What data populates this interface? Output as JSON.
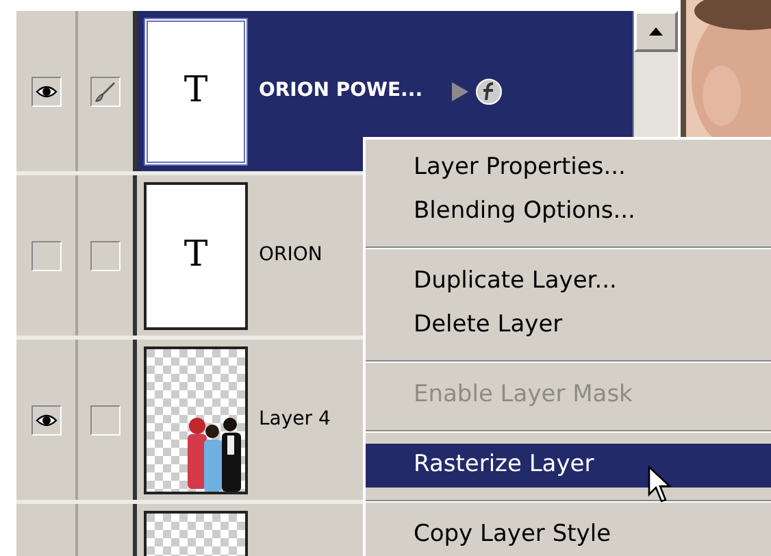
{
  "layers": [
    {
      "name": "ORION POWE...",
      "visible": true,
      "brush": true,
      "selected": true,
      "thumbnail": {
        "kind": "text",
        "glyph": "T"
      },
      "expand_arrow": true,
      "effects": true
    },
    {
      "name": "ORION",
      "visible": false,
      "brush": false,
      "selected": false,
      "thumbnail": {
        "kind": "text",
        "glyph": "T"
      },
      "expand_arrow": false,
      "effects": false
    },
    {
      "name": "Layer 4",
      "visible": true,
      "brush": false,
      "selected": false,
      "expand_arrow": false,
      "effects": false
    },
    {
      "selected": false
    }
  ],
  "context_menu": [
    {
      "kind": "item",
      "label": "Layer Properties...",
      "disabled": false,
      "selected": false
    },
    {
      "kind": "item",
      "label": "Blending Options...",
      "disabled": false,
      "selected": false
    },
    {
      "kind": "separator"
    },
    {
      "kind": "item",
      "label": "Duplicate Layer...",
      "disabled": false,
      "selected": false
    },
    {
      "kind": "item",
      "label": "Delete Layer",
      "disabled": false,
      "selected": false
    },
    {
      "kind": "separator"
    },
    {
      "kind": "item",
      "label": "Enable Layer Mask",
      "disabled": true,
      "selected": false
    },
    {
      "kind": "separator"
    },
    {
      "kind": "item",
      "label": "Rasterize Layer",
      "disabled": false,
      "selected": true
    },
    {
      "kind": "separator"
    },
    {
      "kind": "item",
      "label": "Copy Layer Style",
      "disabled": false,
      "selected": false
    }
  ]
}
